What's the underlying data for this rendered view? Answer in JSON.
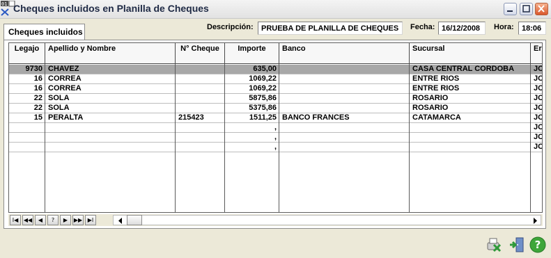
{
  "window": {
    "title": "Cheques incluidos en Planilla de Cheques",
    "corner_badge": "01"
  },
  "tab": {
    "label": "Cheques incluidos"
  },
  "header_fields": {
    "descripcion_label": "Descripción:",
    "descripcion_value": "PRUEBA DE PLANILLA DE CHEQUES",
    "fecha_label": "Fecha:",
    "fecha_value": "16/12/2008",
    "hora_label": "Hora:",
    "hora_value": "18:06"
  },
  "grid": {
    "columns": [
      "Legajo",
      "Apellido y Nombre",
      "N° Cheque",
      "Importe",
      "Banco",
      "Sucursal",
      "Er"
    ],
    "rows": [
      {
        "legajo": "9730",
        "nombre": "CHAVEZ",
        "cheque": "",
        "importe": "635,00",
        "banco": "",
        "sucursal": "CASA CENTRAL CORDOBA",
        "extra": "JO"
      },
      {
        "legajo": "16",
        "nombre": "CORREA",
        "cheque": "",
        "importe": "1069,22",
        "banco": "",
        "sucursal": "ENTRE RIOS",
        "extra": "JO"
      },
      {
        "legajo": "16",
        "nombre": "CORREA",
        "cheque": "",
        "importe": "1069,22",
        "banco": "",
        "sucursal": "ENTRE RIOS",
        "extra": "JO"
      },
      {
        "legajo": "22",
        "nombre": "SOLA",
        "cheque": "",
        "importe": "5875,86",
        "banco": "",
        "sucursal": "ROSARIO",
        "extra": "JO"
      },
      {
        "legajo": "22",
        "nombre": "SOLA",
        "cheque": "",
        "importe": "5375,86",
        "banco": "",
        "sucursal": "ROSARIO",
        "extra": "JO"
      },
      {
        "legajo": "15",
        "nombre": "PERALTA",
        "cheque": "215423",
        "importe": "1511,25",
        "banco": "BANCO FRANCES",
        "sucursal": "CATAMARCA",
        "extra": "JO"
      },
      {
        "legajo": "",
        "nombre": "",
        "cheque": "",
        "importe": ",",
        "banco": "",
        "sucursal": "",
        "extra": "JO"
      },
      {
        "legajo": "",
        "nombre": "",
        "cheque": "",
        "importe": ",",
        "banco": "",
        "sucursal": "",
        "extra": "JO"
      },
      {
        "legajo": "",
        "nombre": "",
        "cheque": "",
        "importe": ",",
        "banco": "",
        "sucursal": "",
        "extra": "JO"
      }
    ],
    "selected_row": 0
  },
  "navigator": {
    "first": "I◀",
    "prev_page": "◀◀",
    "prev": "◀",
    "search": "?",
    "next": "▶",
    "next_page": "▶▶",
    "last": "▶I"
  },
  "colors": {
    "window_bg": "#ece9d8",
    "selected_row": "#a8a8a8",
    "help_green": "#3ea63a"
  }
}
